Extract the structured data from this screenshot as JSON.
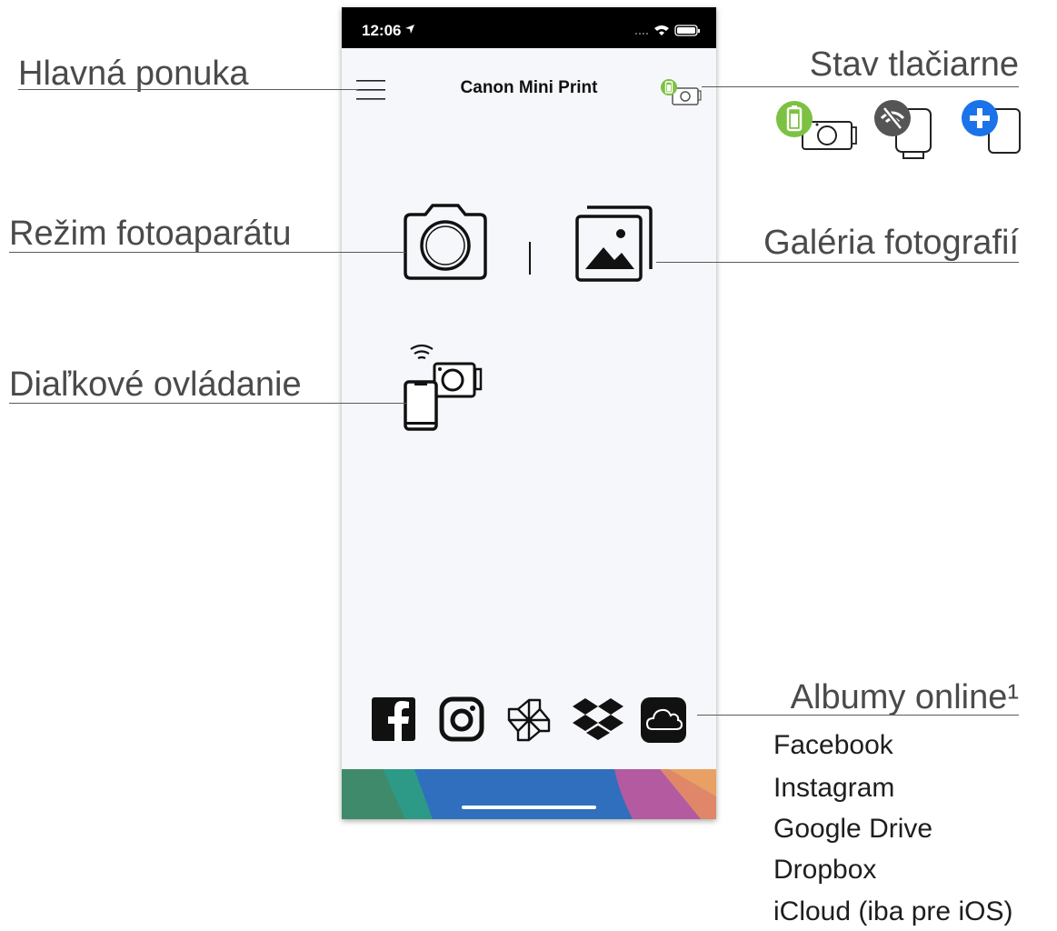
{
  "status_bar": {
    "time": "12:06"
  },
  "app": {
    "title": "Canon Mini Print"
  },
  "callouts": {
    "main_menu": "Hlavná ponuka",
    "printer_status": "Stav tlačiarne",
    "camera_mode": "Režim fotoaparátu",
    "photo_gallery": "Galéria fotografií",
    "remote_control": "Diaľkové ovládanie",
    "online_albums": "Albumy online¹"
  },
  "online_album_services": [
    "Facebook",
    "Instagram",
    "Google Drive",
    "Dropbox",
    "iCloud (iba pre iOS)"
  ],
  "icons": {
    "menu": "hamburger-icon",
    "printer_status": "printer-battery-icon",
    "camera": "camera-icon",
    "gallery": "gallery-icon",
    "remote": "remote-control-icon",
    "status_examples": [
      "printer-battery-icon",
      "printer-disconnected-icon",
      "add-printer-icon"
    ],
    "albums": [
      "facebook-icon",
      "instagram-icon",
      "google-drive-icon",
      "dropbox-icon",
      "icloud-icon"
    ]
  },
  "colors": {
    "battery_green": "#7dc142",
    "add_blue": "#1a73e8",
    "disconnected_gray": "#555555"
  }
}
